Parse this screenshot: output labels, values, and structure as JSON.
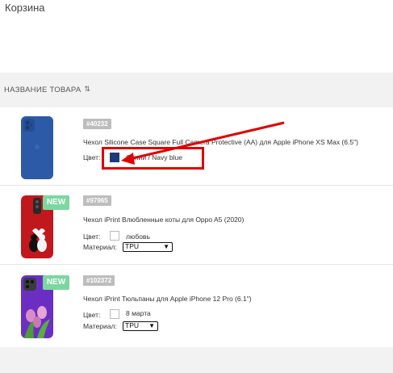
{
  "page": {
    "title": "Корзина"
  },
  "table": {
    "header": "НАЗВАНИЕ ТОВАРА",
    "sort_icon": "⇅"
  },
  "items": [
    {
      "sku": "#40232",
      "name": "Чехол Silicone Case Square Full Camera Protective (AA) для Apple iPhone XS Max (6.5\")",
      "color_label": "Цвет:",
      "color_value": "Синий / Navy blue",
      "swatch_color": "#1f3a78",
      "is_new": false
    },
    {
      "sku": "#97965",
      "name": "Чехол iPrint Влюбленные коты для Oppo A5 (2020)",
      "color_label": "Цвет:",
      "color_value": "любовь",
      "swatch_color": "#ffffff",
      "material_label": "Материал:",
      "material_value": "TPU",
      "new_label": "NEW",
      "is_new": true
    },
    {
      "sku": "#102372",
      "name": "Чехол iPrint Тюльпаны для Apple iPhone 12 Pro (6.1\")",
      "color_label": "Цвет:",
      "color_value": "8 марта",
      "swatch_color": "#ffffff",
      "material_label": "Материал:",
      "material_value": "TPU",
      "new_label": "NEW",
      "is_new": true
    }
  ],
  "annotation": {
    "color": "#e00000"
  }
}
